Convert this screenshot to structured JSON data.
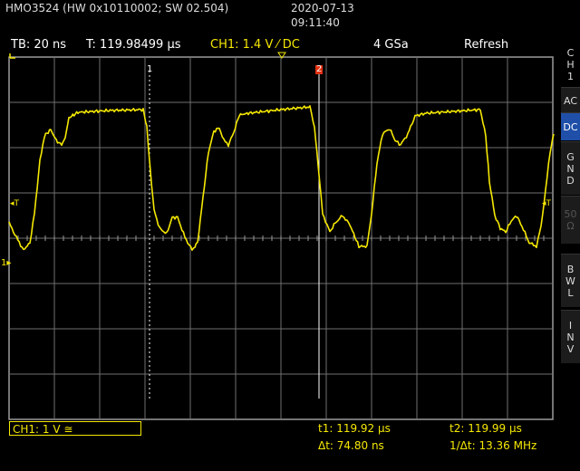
{
  "header": {
    "device": "HMO3524 (HW 0x10110002; SW 02.504)",
    "date": "2020-07-13",
    "time": "09:11:40"
  },
  "status_bar": {
    "timebase": "TB: 20 ns",
    "trigger_time": "T: 119.98499 µs",
    "channel_setting": "CH1: 1.4 V ⁄ DC",
    "sample_rate": "4 GSa",
    "mode": "Refresh"
  },
  "sidebar": {
    "channel_label": [
      "C",
      "H",
      "1"
    ],
    "buttons": [
      {
        "label": [
          "AC"
        ],
        "active": false,
        "enabled": true
      },
      {
        "label": [
          "DC"
        ],
        "active": true,
        "enabled": true
      },
      {
        "label": [
          "G",
          "N",
          "D"
        ],
        "active": false,
        "enabled": true
      },
      {
        "label": [
          "50",
          "Ω"
        ],
        "active": false,
        "enabled": false
      },
      {
        "label": [
          "B",
          "W",
          "L"
        ],
        "active": false,
        "enabled": true
      },
      {
        "label": [
          "I",
          "N",
          "V"
        ],
        "active": false,
        "enabled": true
      }
    ]
  },
  "grid_markers": {
    "cursor1_label": "1",
    "cursor2_label": "2",
    "trigger_left": "◂T",
    "trigger_right": "◂T",
    "ch1_level_marker": "1"
  },
  "bottom": {
    "ch1_scale": "CH1: 1 V ≅",
    "t1": "t1: 119.92 µs",
    "t2": "t2: 119.99 µs",
    "delta_t": "Δt: 74.80 ns",
    "inv_delta_t": "1/Δt: 13.36 MHz"
  },
  "colors": {
    "trace": "#f5e800",
    "grid": "#8a8a8a",
    "background": "#000000",
    "cursor2": "#e03010"
  }
}
